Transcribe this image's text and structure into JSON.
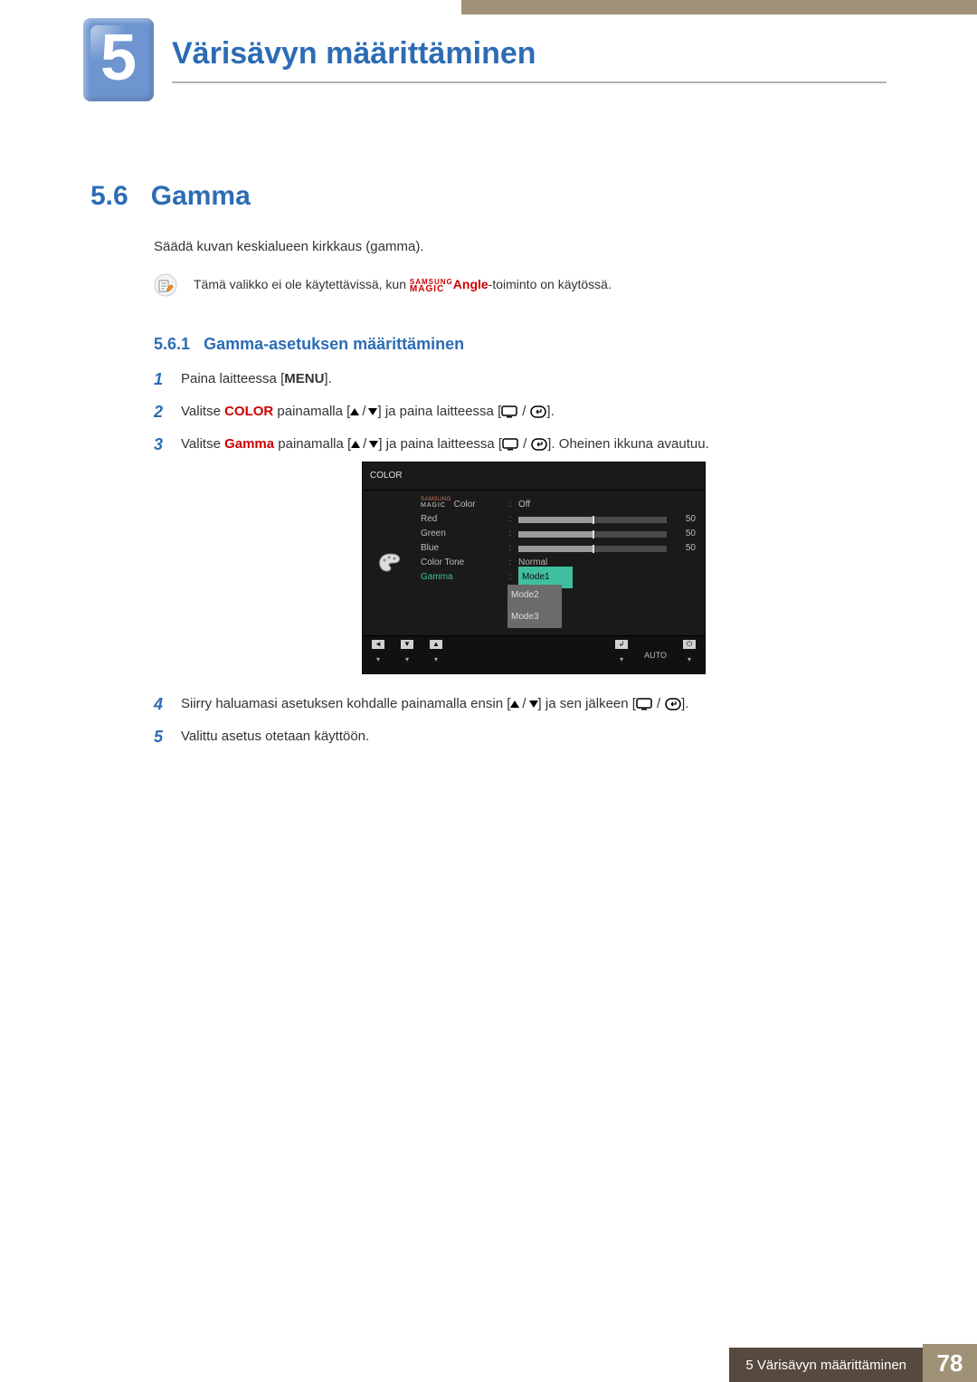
{
  "chapter": {
    "number": "5",
    "title": "Värisävyn määrittäminen"
  },
  "section": {
    "number": "5.6",
    "title": "Gamma"
  },
  "intro": "Säädä kuvan keskialueen kirkkaus (gamma).",
  "note": {
    "pre": "Tämä valikko ei ole käytettävissä, kun ",
    "magic_top": "SAMSUNG",
    "magic_bot": "MAGIC",
    "angle": "Angle",
    "post": "-toiminto on käytössä."
  },
  "subsection": {
    "number": "5.6.1",
    "title": "Gamma-asetuksen määrittäminen"
  },
  "steps": {
    "s1": {
      "num": "1",
      "pre": "Paina laitteessa [",
      "menu": "MENU",
      "post": "]."
    },
    "s2": {
      "num": "2",
      "pre": "Valitse ",
      "color": "COLOR",
      "mid1": " painamalla [",
      "mid2": "] ja paina laitteessa [",
      "post": "]."
    },
    "s3": {
      "num": "3",
      "pre": "Valitse ",
      "gamma": "Gamma",
      "mid1": " painamalla [",
      "mid2": "] ja paina laitteessa [",
      "post": "]. Oheinen ikkuna avautuu."
    },
    "s4": {
      "num": "4",
      "pre": "Siirry haluamasi asetuksen kohdalle painamalla ensin [",
      "mid": "] ja sen jälkeen [",
      "post": "]."
    },
    "s5": {
      "num": "5",
      "text": "Valittu asetus otetaan käyttöön."
    }
  },
  "osd": {
    "title": "COLOR",
    "magic_top": "SAMSUNG",
    "magic_bot": "MAGIC",
    "rows": {
      "magic_color": {
        "label": "Color",
        "value": "Off"
      },
      "red": {
        "label": "Red",
        "value": "50"
      },
      "green": {
        "label": "Green",
        "value": "50"
      },
      "blue": {
        "label": "Blue",
        "value": "50"
      },
      "tone": {
        "label": "Color Tone",
        "value": "Normal"
      },
      "gamma": {
        "label": "Gamma"
      }
    },
    "modes": {
      "m1": "Mode1",
      "m2": "Mode2",
      "m3": "Mode3"
    },
    "footer": {
      "auto": "AUTO"
    }
  },
  "footer": {
    "text": "5 Värisävyn määrittäminen",
    "page": "78"
  },
  "chart_data": null
}
